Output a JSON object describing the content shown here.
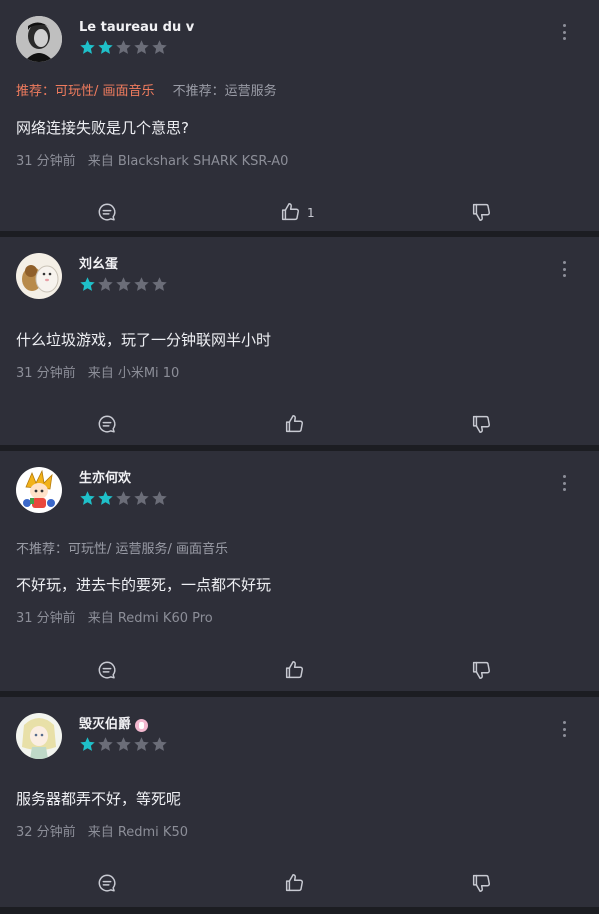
{
  "colors": {
    "background": "#1c1d22",
    "card": "#2e2f39",
    "star_filled": "#1fc0c9",
    "star_empty": "#6b6d78",
    "recommend": "#f07c5e",
    "muted": "#8c8e98"
  },
  "reviews": [
    {
      "user": "Le taureau du v",
      "rating": 2,
      "recommend_label": "推荐：可玩性/ 画面音乐",
      "not_recommend_label": "不推荐：运营服务",
      "text": "网络连接失败是几个意思?",
      "time": "31 分钟前",
      "source": "来自 Blackshark SHARK KSR-A0",
      "like_count": "1",
      "icons": [
        "comment-icon",
        "thumbs-up-icon",
        "thumbs-down-icon",
        "more-icon"
      ]
    },
    {
      "user": "刘幺蛋",
      "rating": 1,
      "recommend_label": "",
      "not_recommend_label": "",
      "text": "什么垃圾游戏，玩了一分钟联网半小时",
      "time": "31 分钟前",
      "source": "来自 小米Mi 10",
      "like_count": "",
      "icons": [
        "comment-icon",
        "thumbs-up-icon",
        "thumbs-down-icon",
        "more-icon"
      ]
    },
    {
      "user": "生亦何欢",
      "rating": 2,
      "recommend_label": "",
      "not_recommend_label": "不推荐：可玩性/ 运营服务/ 画面音乐",
      "text": "不好玩，进去卡的要死，一点都不好玩",
      "time": "31 分钟前",
      "source": "来自 Redmi K60 Pro",
      "like_count": "",
      "icons": [
        "comment-icon",
        "thumbs-up-icon",
        "thumbs-down-icon",
        "more-icon"
      ]
    },
    {
      "user": "毁灭伯爵",
      "rating": 1,
      "recommend_label": "",
      "not_recommend_label": "",
      "text": "服务器都弄不好，等死呢",
      "time": "32 分钟前",
      "source": "来自 Redmi K50",
      "like_count": "",
      "icons": [
        "comment-icon",
        "thumbs-up-icon",
        "thumbs-down-icon",
        "more-icon"
      ]
    }
  ]
}
